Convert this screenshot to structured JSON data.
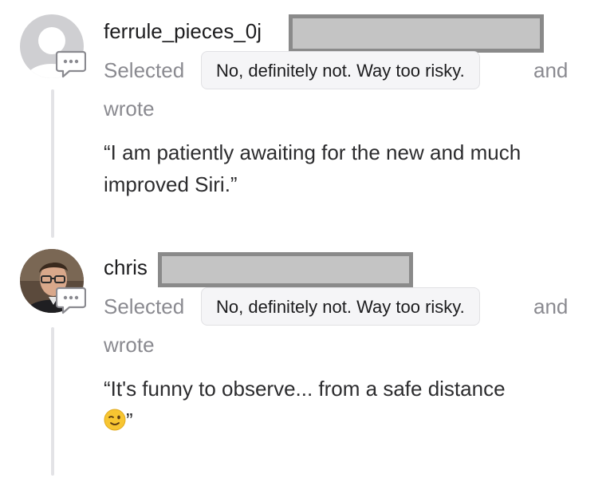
{
  "comments": [
    {
      "username": "ferrule_pieces_0j",
      "avatar": "placeholder-avatar",
      "selected_label": "Selected",
      "selected_option": "No, definitely not. Way too risky.",
      "and_label": "and",
      "wrote_label": "wrote",
      "quote": "“I am patiently awaiting for the new and much improved Siri.”"
    },
    {
      "username": "chris",
      "avatar": "photo-avatar",
      "selected_label": "Selected",
      "selected_option": "No, definitely not. Way too risky.",
      "and_label": "and",
      "wrote_label": "wrote",
      "quote": "“It's funny to observe... from a safe distance",
      "quote_end": "”",
      "quote_emoji": "winking-face-emoji"
    }
  ],
  "colors": {
    "thread_line": "#e3e3e6",
    "chip_background": "#f5f5f7",
    "muted_text": "#8a8a90",
    "redaction_fill": "#c4c4c4",
    "redaction_border": "#8a8a8a"
  }
}
